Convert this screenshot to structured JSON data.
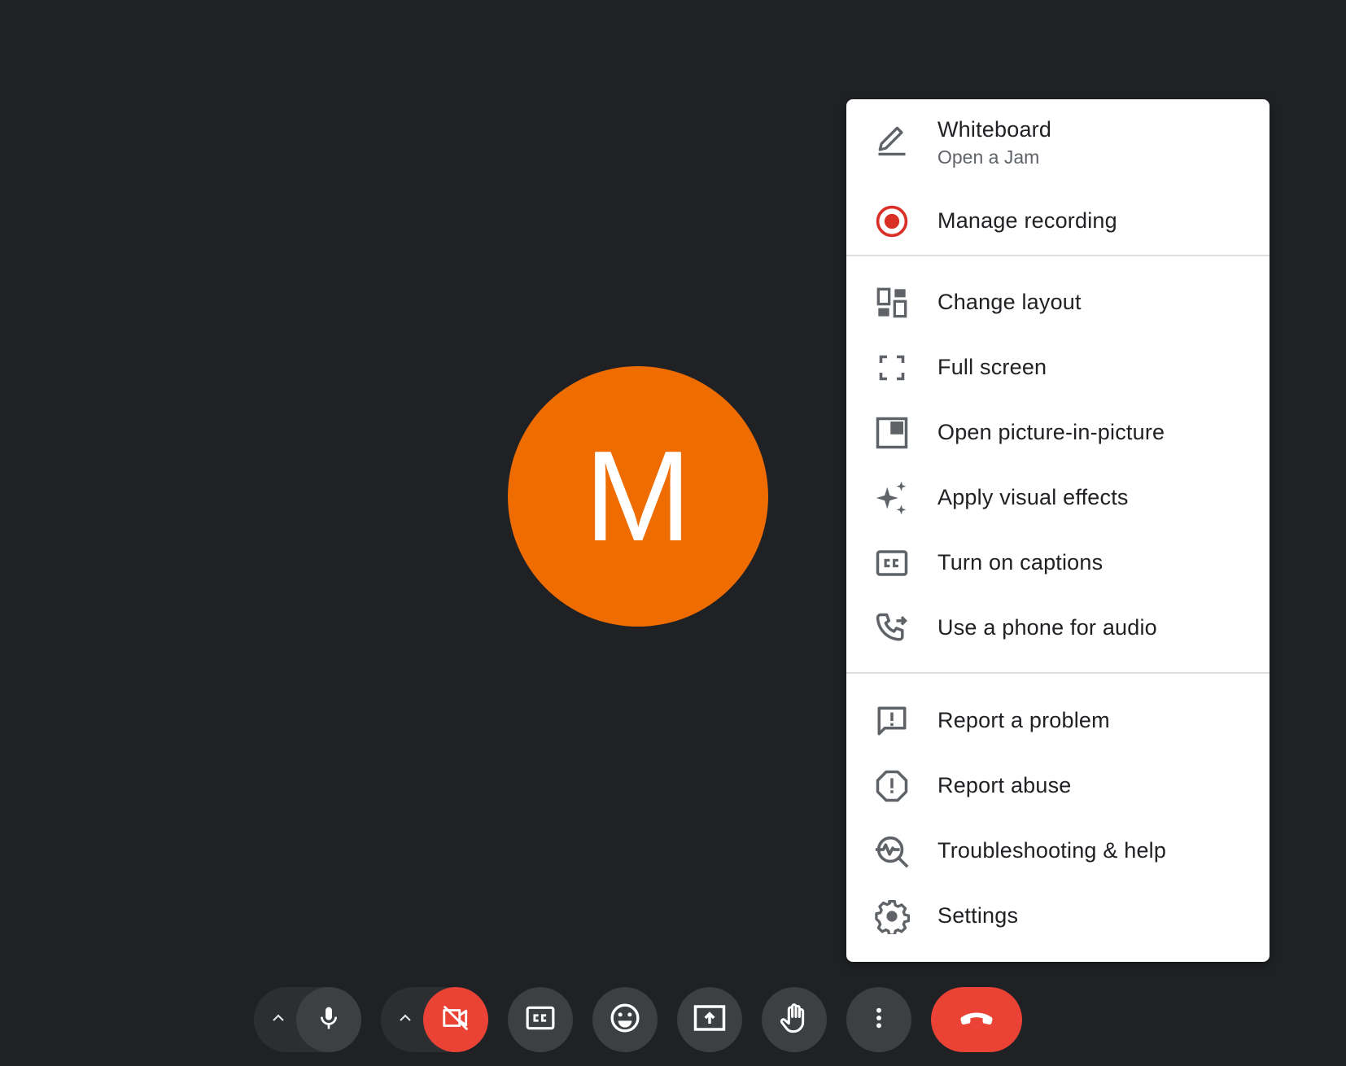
{
  "participant": {
    "initial": "M",
    "avatar_color": "#ef6c00"
  },
  "menu": {
    "items": [
      {
        "label": "Whiteboard",
        "sublabel": "Open a Jam",
        "icon": "pencil-icon"
      },
      {
        "label": "Manage recording",
        "icon": "record-icon"
      },
      {
        "label": "Change layout",
        "icon": "layout-icon"
      },
      {
        "label": "Full screen",
        "icon": "fullscreen-icon"
      },
      {
        "label": "Open picture-in-picture",
        "icon": "picture-in-picture-icon"
      },
      {
        "label": "Apply visual effects",
        "icon": "sparkle-icon"
      },
      {
        "label": "Turn on captions",
        "icon": "captions-icon"
      },
      {
        "label": "Use a phone for audio",
        "icon": "phone-forward-icon"
      },
      {
        "label": "Report a problem",
        "icon": "feedback-icon"
      },
      {
        "label": "Report abuse",
        "icon": "report-icon"
      },
      {
        "label": "Troubleshooting & help",
        "icon": "troubleshoot-icon"
      },
      {
        "label": "Settings",
        "icon": "gear-icon"
      }
    ]
  },
  "toolbar": {
    "buttons": [
      {
        "name": "mic-options",
        "icon": "chevron-up-icon"
      },
      {
        "name": "microphone",
        "icon": "microphone-icon"
      },
      {
        "name": "camera-options",
        "icon": "chevron-up-icon"
      },
      {
        "name": "camera-off",
        "icon": "camera-off-icon"
      },
      {
        "name": "captions",
        "icon": "captions-icon"
      },
      {
        "name": "reactions",
        "icon": "emoji-icon"
      },
      {
        "name": "present",
        "icon": "present-screen-icon"
      },
      {
        "name": "raise-hand",
        "icon": "hand-icon"
      },
      {
        "name": "more-options",
        "icon": "more-vertical-icon"
      },
      {
        "name": "leave-call",
        "icon": "end-call-icon"
      }
    ]
  },
  "colors": {
    "background": "#202124",
    "menu_icon": "#5f6368",
    "record_red": "#d93025",
    "danger_red": "#ea4335",
    "toolbar_button": "#3c4043"
  }
}
